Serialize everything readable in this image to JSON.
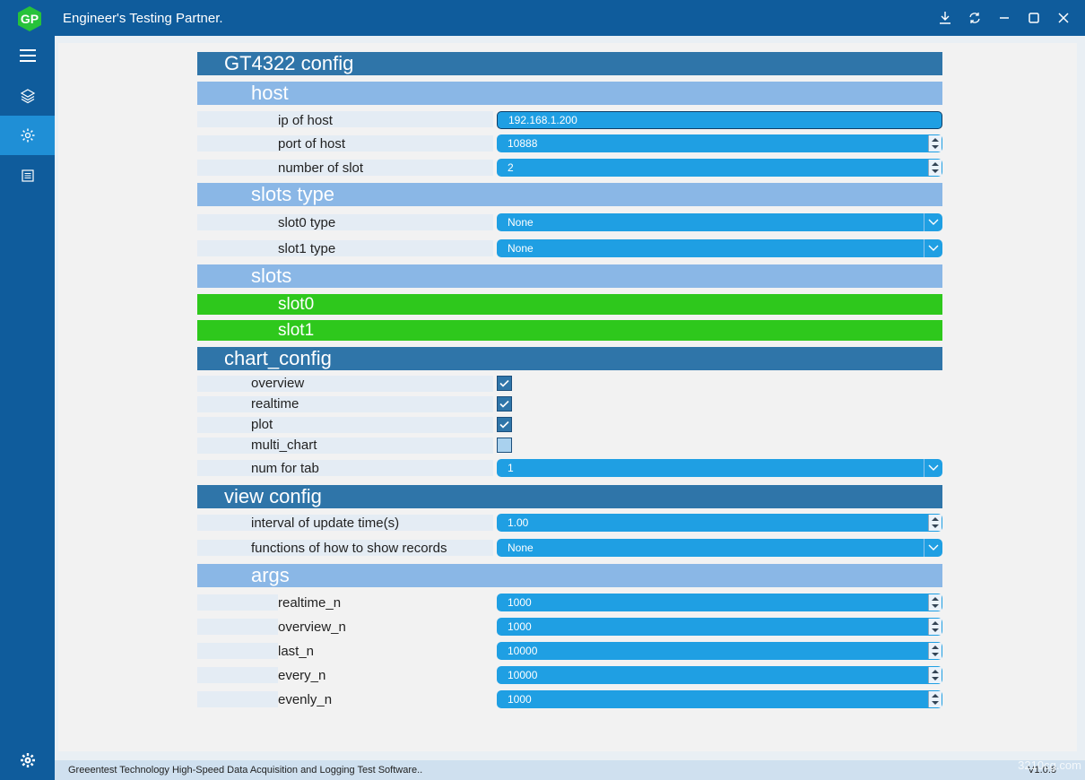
{
  "window": {
    "title": "Engineer's Testing Partner.",
    "controls": [
      "download-icon",
      "sync-icon",
      "minimize-icon",
      "maximize-icon",
      "close-icon"
    ]
  },
  "sidebar": {
    "items": [
      "menu-icon",
      "layers-icon",
      "gear-icon",
      "document-icon"
    ],
    "active": "gear-icon",
    "bottom": "settings-icon"
  },
  "sections": {
    "main": "GT4322 config",
    "host": "host",
    "slots_type": "slots type",
    "slots": "slots",
    "chart_config": "chart_config",
    "view_config": "view config",
    "args": "args"
  },
  "host": {
    "ip_label": "ip of host",
    "ip_value": "192.168.1.200",
    "port_label": "port of host",
    "port_value": "10888",
    "slot_count_label": "number of slot",
    "slot_count_value": "2"
  },
  "slots_type": {
    "slot0_label": "slot0 type",
    "slot0_value": "None",
    "slot1_label": "slot1 type",
    "slot1_value": "None"
  },
  "slots": {
    "slot0": "slot0",
    "slot1": "slot1"
  },
  "chart": {
    "overview_label": "overview",
    "overview_checked": true,
    "realtime_label": "realtime",
    "realtime_checked": true,
    "plot_label": "plot",
    "plot_checked": true,
    "multi_chart_label": "multi_chart",
    "multi_chart_checked": false,
    "num_tab_label": "num for tab",
    "num_tab_value": "1"
  },
  "view": {
    "interval_label": "interval of update time(s)",
    "interval_value": "1.00",
    "functions_label": "functions of how to show records",
    "functions_value": "None"
  },
  "args": {
    "realtime_n_label": "realtime_n",
    "realtime_n_value": "1000",
    "overview_n_label": "overview_n",
    "overview_n_value": "1000",
    "last_n_label": "last_n",
    "last_n_value": "10000",
    "every_n_label": "every_n",
    "every_n_value": "10000",
    "evenly_n_label": "evenly_n",
    "evenly_n_value": "1000"
  },
  "footer": {
    "text": "Greeentest Technology High-Speed Data Acquisition and Logging Test Software..",
    "version": "V1.0.8",
    "watermark": "3210cg.com"
  },
  "colors": {
    "titlebar": "#0f5c9c",
    "header": "#2f75a9",
    "subheader": "#8ab7e6",
    "field": "#1f9fe3",
    "slot": "#2ec81c"
  }
}
